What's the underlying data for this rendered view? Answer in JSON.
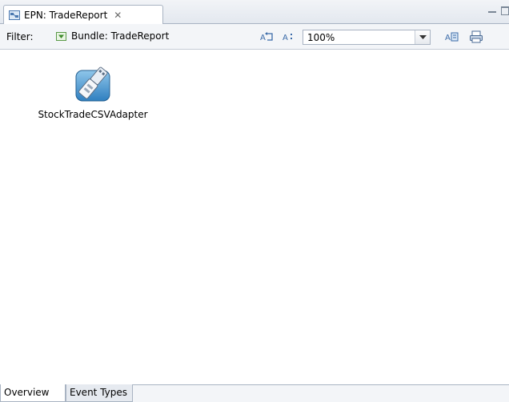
{
  "editor": {
    "tab_title": "EPN: TradeReport",
    "close_glyph": "✕"
  },
  "toolbar": {
    "filter_label": "Filter:",
    "bundle_label": "Bundle: TradeReport",
    "zoom_value": "100%",
    "icons": [
      "layout-icon",
      "sort-icon",
      "export-icon",
      "print-icon"
    ]
  },
  "canvas": {
    "nodes": [
      {
        "label": "StockTradeCSVAdapter",
        "icon": "adapter-icon"
      }
    ]
  },
  "bottom_tabs": [
    {
      "label": "Overview",
      "active": true
    },
    {
      "label": "Event Types",
      "active": false
    }
  ],
  "colors": {
    "accent": "#3a8fd6",
    "tab_border": "#a8b3c2"
  }
}
